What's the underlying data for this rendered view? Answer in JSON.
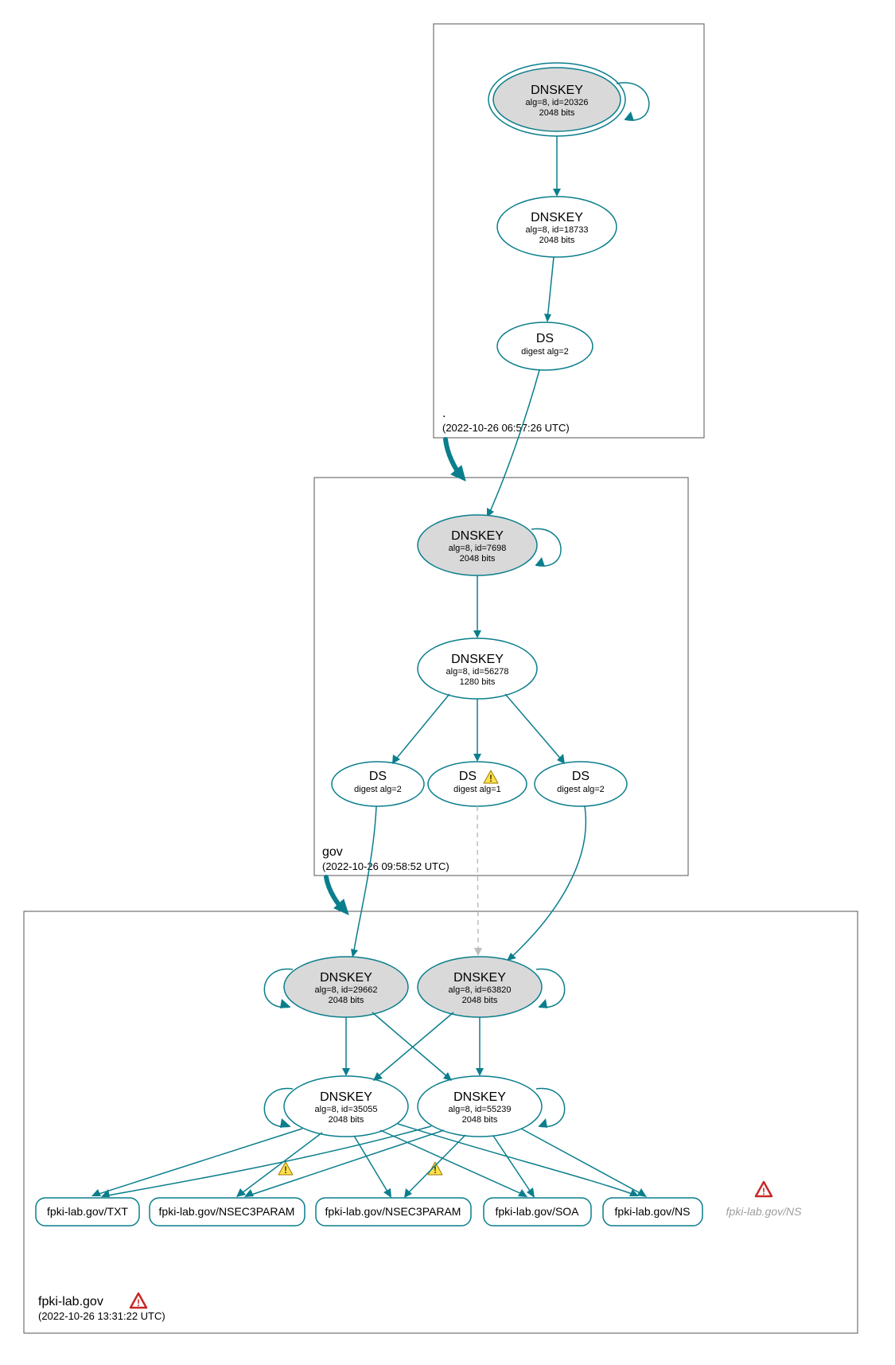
{
  "colors": {
    "accent": "#0a7e8c",
    "nodeGrey": "#d9d9d9"
  },
  "zones": {
    "root": {
      "label": ".",
      "date": "(2022-10-26 06:57:26 UTC)"
    },
    "gov": {
      "label": "gov",
      "date": "(2022-10-26 09:58:52 UTC)"
    },
    "fpki": {
      "label": "fpki-lab.gov",
      "date": "(2022-10-26 13:31:22 UTC)"
    }
  },
  "nodes": {
    "root_ksk": {
      "title": "DNSKEY",
      "line1": "alg=8, id=20326",
      "line2": "2048 bits"
    },
    "root_zsk": {
      "title": "DNSKEY",
      "line1": "alg=8, id=18733",
      "line2": "2048 bits"
    },
    "root_ds": {
      "title": "DS",
      "line1": "digest alg=2"
    },
    "gov_ksk": {
      "title": "DNSKEY",
      "line1": "alg=8, id=7698",
      "line2": "2048 bits"
    },
    "gov_zsk": {
      "title": "DNSKEY",
      "line1": "alg=8, id=56278",
      "line2": "1280 bits"
    },
    "gov_ds1": {
      "title": "DS",
      "line1": "digest alg=2"
    },
    "gov_ds2": {
      "title": "DS",
      "line1": "digest alg=1"
    },
    "gov_ds3": {
      "title": "DS",
      "line1": "digest alg=2"
    },
    "fpki_ksk1": {
      "title": "DNSKEY",
      "line1": "alg=8, id=29662",
      "line2": "2048 bits"
    },
    "fpki_ksk2": {
      "title": "DNSKEY",
      "line1": "alg=8, id=63820",
      "line2": "2048 bits"
    },
    "fpki_zsk1": {
      "title": "DNSKEY",
      "line1": "alg=8, id=35055",
      "line2": "2048 bits"
    },
    "fpki_zsk2": {
      "title": "DNSKEY",
      "line1": "alg=8, id=55239",
      "line2": "2048 bits"
    }
  },
  "records": {
    "txt": "fpki-lab.gov/TXT",
    "nsec1": "fpki-lab.gov/NSEC3PARAM",
    "nsec2": "fpki-lab.gov/NSEC3PARAM",
    "soa": "fpki-lab.gov/SOA",
    "ns": "fpki-lab.gov/NS",
    "ns_err": "fpki-lab.gov/NS"
  }
}
